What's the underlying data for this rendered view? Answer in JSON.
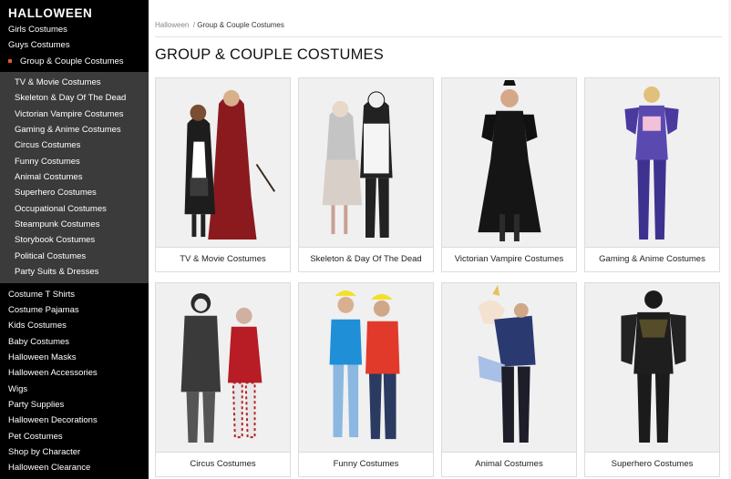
{
  "sidebar": {
    "title": "HALLOWEEN",
    "top_items": [
      "Girls Costumes",
      "Guys Costumes"
    ],
    "active_item": "Group & Couple Costumes",
    "sub_items": [
      "TV & Movie Costumes",
      "Skeleton & Day Of The Dead",
      "Victorian Vampire Costumes",
      "Gaming & Anime Costumes",
      "Circus Costumes",
      "Funny Costumes",
      "Animal Costumes",
      "Superhero Costumes",
      "Occupational Costumes",
      "Steampunk Costumes",
      "Storybook Costumes",
      "Political Costumes",
      "Party Suits & Dresses"
    ],
    "bottom_items": [
      "Costume T Shirts",
      "Costume Pajamas",
      "Kids Costumes",
      "Baby Costumes",
      "Halloween Masks",
      "Halloween Accessories",
      "Wigs",
      "Party Supplies",
      "Halloween Decorations",
      "Pet Costumes",
      "Shop by Character",
      "Halloween Clearance"
    ],
    "accent_color": "#e8542a"
  },
  "breadcrumb": {
    "root": "Halloween",
    "separator": "/",
    "current": "Group & Couple Costumes"
  },
  "page_title": "GROUP & COUPLE COSTUMES",
  "cards": [
    {
      "label": "TV & Movie Costumes",
      "image": "wizard-couple-photo"
    },
    {
      "label": "Skeleton & Day Of The Dead",
      "image": "skeleton-couple-photo"
    },
    {
      "label": "Victorian Vampire Costumes",
      "image": "vampire-woman-photo"
    },
    {
      "label": "Gaming & Anime Costumes",
      "image": "gamer-bodysuit-photo"
    },
    {
      "label": "Circus Costumes",
      "image": "clown-couple-photo"
    },
    {
      "label": "Funny Costumes",
      "image": "hard-hat-couple-photo"
    },
    {
      "label": "Animal Costumes",
      "image": "unicorn-rider-photo"
    },
    {
      "label": "Superhero Costumes",
      "image": "panther-hero-photo"
    }
  ]
}
